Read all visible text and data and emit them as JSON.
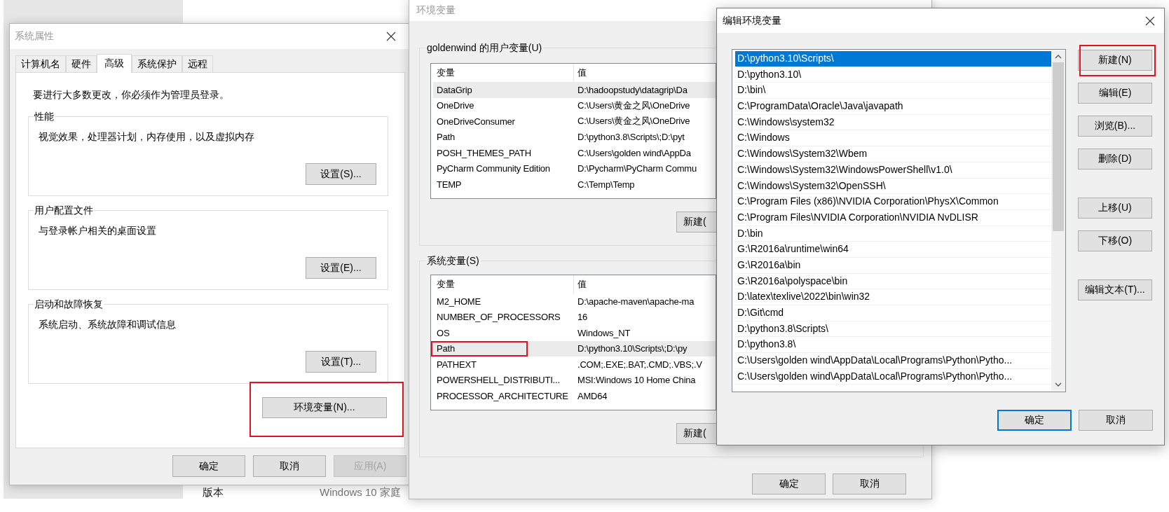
{
  "settings_page": {
    "label": "版本",
    "value": "Windows 10 家庭"
  },
  "system_properties": {
    "title": "系统属性",
    "tabs": [
      {
        "label": "计算机名",
        "selected": false
      },
      {
        "label": "硬件",
        "selected": false
      },
      {
        "label": "高级",
        "selected": true
      },
      {
        "label": "系统保护",
        "selected": false
      },
      {
        "label": "远程",
        "selected": false
      }
    ],
    "note": "要进行大多数更改，你必须作为管理员登录。",
    "groups": [
      {
        "title": "性能",
        "description": "视觉效果，处理器计划，内存使用，以及虚拟内存",
        "button": "设置(S)..."
      },
      {
        "title": "用户配置文件",
        "description": "与登录帐户相关的桌面设置",
        "button": "设置(E)..."
      },
      {
        "title": "启动和故障恢复",
        "description": "系统启动、系统故障和调试信息",
        "button": "设置(T)..."
      }
    ],
    "env_button": {
      "label": "环境变量(N)...",
      "highlighted": true
    },
    "buttons": [
      {
        "label": "确定",
        "disabled": false
      },
      {
        "label": "取消",
        "disabled": false
      },
      {
        "label": "应用(A)",
        "disabled": true
      }
    ]
  },
  "environment_variables": {
    "title": "环境变量",
    "sections": [
      {
        "title": "goldenwind 的用户变量(U)",
        "columns": [
          "变量",
          "值"
        ],
        "button": "新建(",
        "rows": [
          {
            "name": "DataGrip",
            "value": "D:\\hadoopstudy\\datagrip\\Da",
            "selected": true,
            "highlighted": false
          },
          {
            "name": "OneDrive",
            "value": "C:\\Users\\黄金之风\\OneDrive",
            "selected": false,
            "highlighted": false
          },
          {
            "name": "OneDriveConsumer",
            "value": "C:\\Users\\黄金之风\\OneDrive",
            "selected": false,
            "highlighted": false
          },
          {
            "name": "Path",
            "value": "D:\\python3.8\\Scripts\\;D:\\pyt",
            "selected": false,
            "highlighted": false
          },
          {
            "name": "POSH_THEMES_PATH",
            "value": "C:\\Users\\golden wind\\AppDa",
            "selected": false,
            "highlighted": false
          },
          {
            "name": "PyCharm Community Edition",
            "value": "D:\\Pycharm\\PyCharm Commu",
            "selected": false,
            "highlighted": false
          },
          {
            "name": "TEMP",
            "value": "C:\\Temp\\Temp",
            "selected": false,
            "highlighted": false
          }
        ]
      },
      {
        "title": "系统变量(S)",
        "columns": [
          "变量",
          "值"
        ],
        "button": "新建(",
        "rows": [
          {
            "name": "M2_HOME",
            "value": "D:\\apache-maven\\apache-ma",
            "selected": false,
            "highlighted": false
          },
          {
            "name": "NUMBER_OF_PROCESSORS",
            "value": "16",
            "selected": false,
            "highlighted": false
          },
          {
            "name": "OS",
            "value": "Windows_NT",
            "selected": false,
            "highlighted": false
          },
          {
            "name": "Path",
            "value": "D:\\python3.10\\Scripts\\;D:\\py",
            "selected": true,
            "highlighted": true
          },
          {
            "name": "PATHEXT",
            "value": ".COM;.EXE;.BAT;.CMD;.VBS;.V",
            "selected": false,
            "highlighted": false
          },
          {
            "name": "POWERSHELL_DISTRIBUTI...",
            "value": "MSI:Windows 10 Home China",
            "selected": false,
            "highlighted": false
          },
          {
            "name": "PROCESSOR_ARCHITECTURE",
            "value": "AMD64",
            "selected": false,
            "highlighted": false
          }
        ]
      }
    ],
    "buttons": [
      "确定",
      "取消"
    ]
  },
  "edit_environment_variable": {
    "title": "编辑环境变量",
    "entries": [
      {
        "path": "D:\\python3.10\\Scripts\\",
        "selected": true
      },
      {
        "path": "D:\\python3.10\\",
        "selected": false
      },
      {
        "path": "D:\\bin\\",
        "selected": false
      },
      {
        "path": "C:\\ProgramData\\Oracle\\Java\\javapath",
        "selected": false
      },
      {
        "path": "C:\\Windows\\system32",
        "selected": false
      },
      {
        "path": "C:\\Windows",
        "selected": false
      },
      {
        "path": "C:\\Windows\\System32\\Wbem",
        "selected": false
      },
      {
        "path": "C:\\Windows\\System32\\WindowsPowerShell\\v1.0\\",
        "selected": false
      },
      {
        "path": "C:\\Windows\\System32\\OpenSSH\\",
        "selected": false
      },
      {
        "path": "C:\\Program Files (x86)\\NVIDIA Corporation\\PhysX\\Common",
        "selected": false
      },
      {
        "path": "C:\\Program Files\\NVIDIA Corporation\\NVIDIA NvDLISR",
        "selected": false
      },
      {
        "path": "D:\\bin",
        "selected": false
      },
      {
        "path": "G:\\R2016a\\runtime\\win64",
        "selected": false
      },
      {
        "path": "G:\\R2016a\\bin",
        "selected": false
      },
      {
        "path": "G:\\R2016a\\polyspace\\bin",
        "selected": false
      },
      {
        "path": "D:\\latex\\texlive\\2022\\bin\\win32",
        "selected": false
      },
      {
        "path": "D:\\Git\\cmd",
        "selected": false
      },
      {
        "path": "D:\\python3.8\\Scripts\\",
        "selected": false
      },
      {
        "path": "D:\\python3.8\\",
        "selected": false
      },
      {
        "path": "C:\\Users\\golden wind\\AppData\\Local\\Programs\\Python\\Pytho...",
        "selected": false
      },
      {
        "path": "C:\\Users\\golden wind\\AppData\\Local\\Programs\\Python\\Pytho...",
        "selected": false
      }
    ],
    "button_groups": [
      [
        {
          "label": "新建(N)",
          "highlighted": true
        },
        {
          "label": "编辑(E)",
          "highlighted": false
        },
        {
          "label": "浏览(B)...",
          "highlighted": false
        },
        {
          "label": "删除(D)",
          "highlighted": false
        }
      ],
      [
        {
          "label": "上移(U)",
          "highlighted": false
        },
        {
          "label": "下移(O)",
          "highlighted": false
        }
      ],
      [
        {
          "label": "编辑文本(T)...",
          "highlighted": false
        }
      ]
    ],
    "buttons": [
      {
        "label": "确定",
        "default": true
      },
      {
        "label": "取消",
        "default": false
      }
    ]
  }
}
